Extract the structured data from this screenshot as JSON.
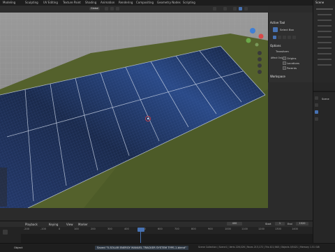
{
  "menu": {
    "tabs": [
      "Modeling",
      "Sculpting",
      "UV Editing",
      "Texture Paint",
      "Shading",
      "Animation",
      "Rendering",
      "Compositing",
      "Geometry Nodes",
      "Scripting"
    ],
    "active": "Options"
  },
  "header": {
    "mode": "Global",
    "options_label": "Options"
  },
  "tool_panel": {
    "active_tool_title": "Active Tool",
    "select_box_label": "Select Box",
    "options_title": "Options",
    "transform_title": "Transform",
    "affect_only_label": "Affect Only",
    "origins_label": "Origins",
    "locations_label": "Locations",
    "parents_label": "Parents",
    "workspace_title": "Workspace"
  },
  "right_panel": {
    "scene_label": "Scene",
    "tab_label": "Scene"
  },
  "timeline": {
    "playback_label": "Playback",
    "keying_label": "Keying",
    "view_label": "View",
    "marker_label": "Marker",
    "current_frame": "400",
    "start_label": "Start",
    "start_value": "1",
    "end_label": "End",
    "end_value": "1520",
    "ticks": [
      "-200",
      "-100",
      "0",
      "100",
      "200",
      "300",
      "400",
      "500",
      "600",
      "700",
      "800",
      "900",
      "1000",
      "1100",
      "1200",
      "1300",
      "1400"
    ]
  },
  "status": {
    "left_label": "Object",
    "message": "Saved \"5-SOLAR ENERGY MANUEL TRACKER SYSTEM TYPE-1.blend\"",
    "stats": "Scene Collection | Scene1 | Verts 226,026 | Faces 213,172 | Tris 421,948 | Objects 0/5421 | Memory 1.51 GiB"
  },
  "colors": {
    "grass": "#54612c",
    "panel": "#1b2a48",
    "sky": "#8b8b8b",
    "accent": "#4772b3"
  }
}
